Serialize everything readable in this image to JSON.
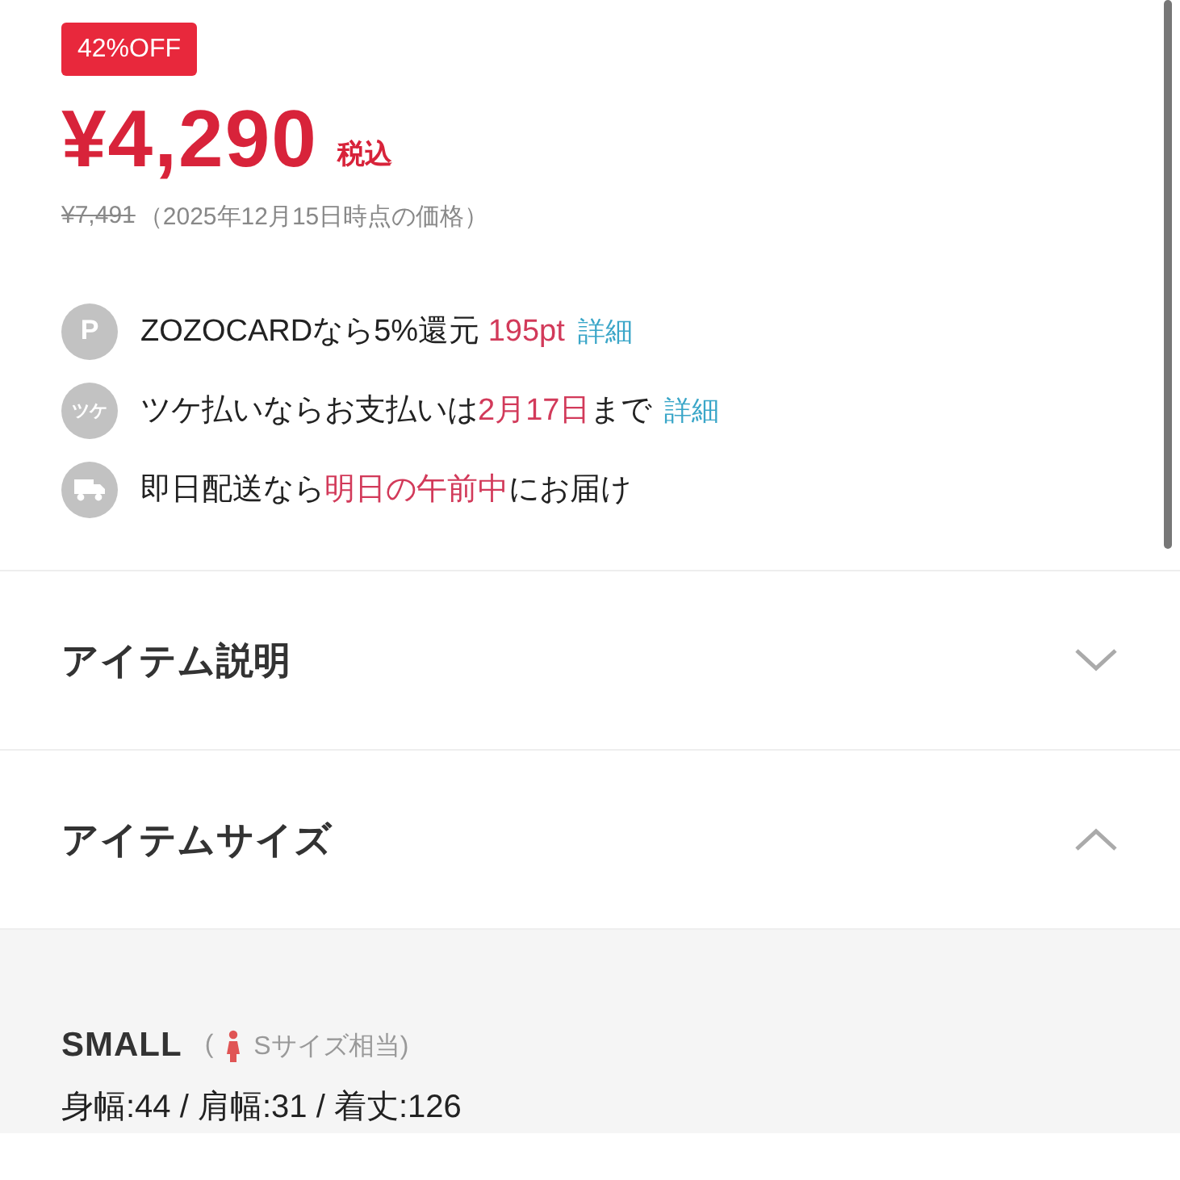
{
  "badge": "42%OFF",
  "price": "¥4,290",
  "tax_label": "税込",
  "original_price": "¥7,491",
  "price_note": "（2025年12月15日時点の価格）",
  "benefits": [
    {
      "icon": {
        "kind": "letter",
        "text": "P"
      },
      "segments": [
        {
          "kind": "plain",
          "text": "ZOZOCARDなら5%還元 "
        },
        {
          "kind": "highlight",
          "text": "195pt"
        },
        {
          "kind": "link",
          "text": "詳細"
        }
      ]
    },
    {
      "icon": {
        "kind": "letter",
        "text": "ツケ"
      },
      "segments": [
        {
          "kind": "plain",
          "text": "ツケ払いならお支払いは"
        },
        {
          "kind": "highlight",
          "text": "2月17日"
        },
        {
          "kind": "plain",
          "text": "まで"
        },
        {
          "kind": "link",
          "text": "詳細"
        }
      ]
    },
    {
      "icon": {
        "kind": "truck"
      },
      "segments": [
        {
          "kind": "plain",
          "text": "即日配送なら"
        },
        {
          "kind": "highlight",
          "text": "明日の午前中"
        },
        {
          "kind": "plain",
          "text": "にお届け"
        }
      ]
    }
  ],
  "sections": [
    {
      "title": "アイテム説明",
      "expanded": false
    },
    {
      "title": "アイテムサイズ",
      "expanded": true
    }
  ],
  "size": {
    "name": "SMALL",
    "note_open": "(",
    "note": "Sサイズ相当)",
    "measurements": "身幅:44 / 肩幅:31 / 着丈:126"
  }
}
